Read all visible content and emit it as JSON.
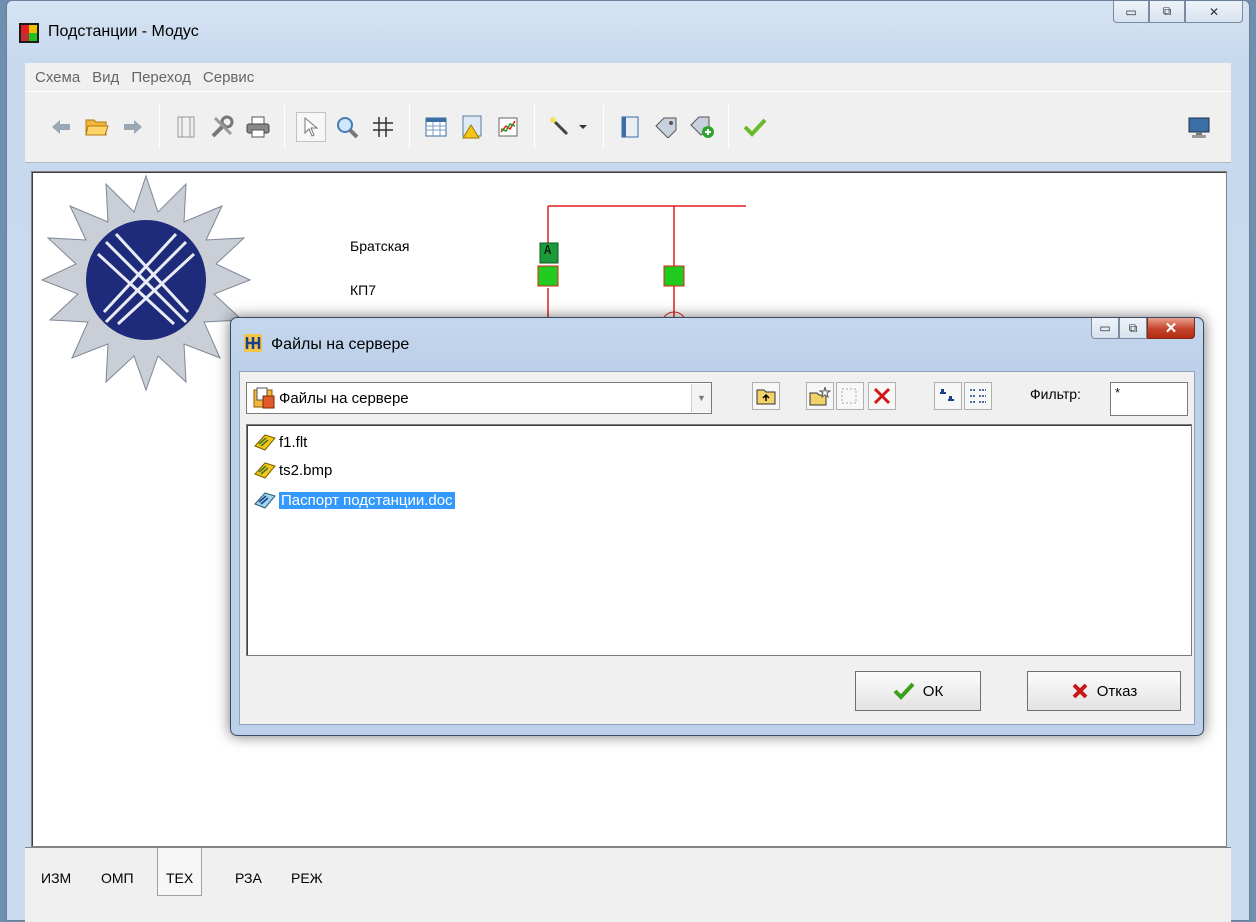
{
  "window": {
    "title": "Подстанции - Модус",
    "controls": {
      "minimize": "▭",
      "maximize": "⧉",
      "close": "✕"
    }
  },
  "menu": {
    "items": [
      "Схема",
      "Вид",
      "Переход",
      "Сервис"
    ]
  },
  "toolbar": {
    "icons": [
      "back-arrow-icon",
      "open-folder-icon",
      "forward-arrow-icon",
      "frame-icon",
      "tools-icon",
      "print-icon",
      "pointer-icon",
      "zoom-icon",
      "grid-icon",
      "table-icon",
      "warning-report-icon",
      "chart-icon",
      "magic-wand-icon",
      "book-icon",
      "tag-icon",
      "tag-add-icon",
      "checkmark-icon",
      "monitor-icon"
    ]
  },
  "schema": {
    "labels": {
      "station": "Братская",
      "kp": "КП7",
      "badge": "A"
    }
  },
  "status_tabs": [
    "ИЗМ",
    "ОМП",
    "ТЕХ",
    "РЗА",
    "РЕЖ"
  ],
  "dialog": {
    "title": "Файлы на сервере",
    "location": "Файлы на сервере",
    "filter_label": "Фильтр:",
    "filter_value": "*",
    "files": [
      {
        "name": "f1.flt",
        "selected": false
      },
      {
        "name": "ts2.bmp",
        "selected": false
      },
      {
        "name": "Паспорт подстанции.doc",
        "selected": true
      }
    ],
    "ok_label": "ОК",
    "cancel_label": "Отказ"
  },
  "colors": {
    "accent_selection": "#3399ff",
    "schema_line": "#e02020",
    "breaker_green": "#1ecb1e"
  }
}
